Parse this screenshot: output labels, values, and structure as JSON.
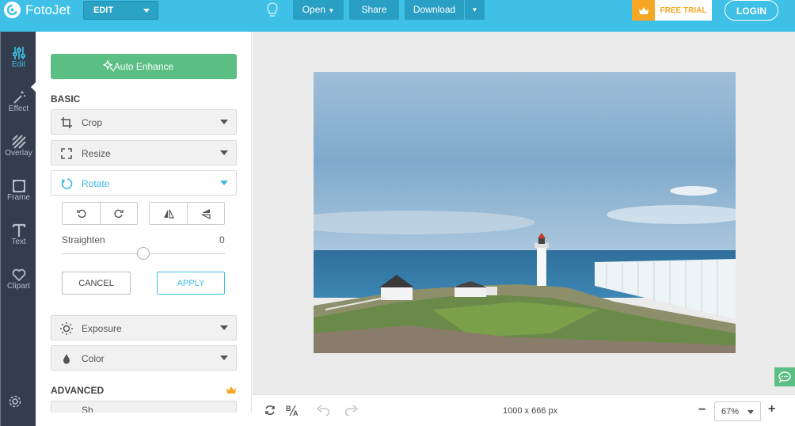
{
  "app": {
    "name": "FotoJet",
    "mode": "EDIT"
  },
  "toolbar": {
    "open": "Open",
    "share": "Share",
    "download": "Download",
    "free_trial": "FREE TRIAL",
    "login": "LOGIN"
  },
  "rail": {
    "items": [
      {
        "label": "Edit",
        "icon": "sliders-icon"
      },
      {
        "label": "Effect",
        "icon": "magic-wand-icon"
      },
      {
        "label": "Overlay",
        "icon": "stripes-icon"
      },
      {
        "label": "Frame",
        "icon": "frame-icon"
      },
      {
        "label": "Text",
        "icon": "text-icon"
      },
      {
        "label": "Clipart",
        "icon": "heart-icon"
      }
    ]
  },
  "panel": {
    "auto_enhance": "Auto Enhance",
    "basic_label": "BASIC",
    "basic_items": [
      {
        "label": "Crop",
        "icon": "crop-icon"
      },
      {
        "label": "Resize",
        "icon": "resize-icon"
      },
      {
        "label": "Rotate",
        "icon": "rotate-icon"
      }
    ],
    "rotate": {
      "straighten_label": "Straighten",
      "straighten_value": "0",
      "cancel": "CANCEL",
      "apply": "APPLY"
    },
    "more_items": [
      {
        "label": "Exposure",
        "icon": "sun-icon"
      },
      {
        "label": "Color",
        "icon": "droplet-icon"
      }
    ],
    "advanced_label": "ADVANCED",
    "advanced_partial": "Sh"
  },
  "canvas": {
    "dimensions": "1000 x 666 px",
    "zoom": "67%"
  },
  "colors": {
    "topbar": "#3fc0e6",
    "rail": "#333d4d",
    "accent_green": "#5bbf84",
    "trial_orange": "#f5a623"
  }
}
